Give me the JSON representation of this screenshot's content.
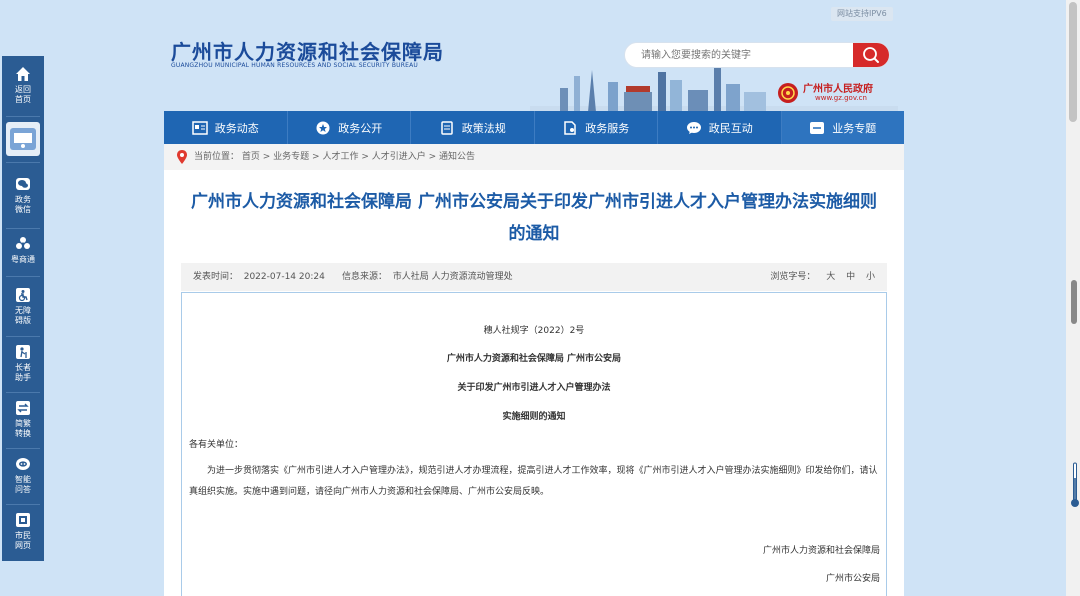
{
  "header": {
    "ipv6": "网站支持IPV6",
    "site_title": "广州市人力资源和社会保障局",
    "site_title_en": "GUANGZHOU MUNICIPAL HUMAN RESOURCES AND SOCIAL SECURITY BUREAU",
    "search_placeholder": "请输入您要搜索的关键字",
    "gov_name": "广州市人民政府",
    "gov_url": "www.gz.gov.cn"
  },
  "nav": [
    {
      "label": "政务动态",
      "icon": "news-icon"
    },
    {
      "label": "政务公开",
      "icon": "star-icon"
    },
    {
      "label": "政策法规",
      "icon": "book-icon"
    },
    {
      "label": "政务服务",
      "icon": "document-icon"
    },
    {
      "label": "政民互动",
      "icon": "chat-icon"
    },
    {
      "label": "业务专题",
      "icon": "list-icon"
    }
  ],
  "breadcrumb": {
    "prefix": "当前位置：",
    "items": [
      "首页",
      "业务专题",
      "人才工作",
      "人才引进入户",
      "通知公告"
    ],
    "sep": " > "
  },
  "article": {
    "title_line1": "广州市人力资源和社会保障局 广州市公安局关于印发广州市引进人才入户管理办法实施细则",
    "title_line2": "的通知",
    "meta_left": "发表时间：  2022-07-14 20:24      信息来源：  市人社局 人力资源流动管理处",
    "font_label": "浏览字号：",
    "font_large": "大",
    "font_medium": "中",
    "font_small": "小",
    "doc_number": "穗人社规字（2022）2号",
    "heading1": "广州市人力资源和社会保障局  广州市公安局",
    "heading2": "关于印发广州市引进人才入户管理办法",
    "heading3": "实施细则的通知",
    "salutation": "各有关单位：",
    "body": "为进一步贯彻落实《广州市引进人才入户管理办法》，规范引进人才办理流程，提高引进人才工作效率，现将《广州市引进人才入户管理办法实施细则》印发给你们，请认真组织实施。实施中遇到问题，请径向广州市人力资源和社会保障局、广州市公安局反映。",
    "sign1": "广州市人力资源和社会保障局",
    "sign2": "广州市公安局"
  },
  "sidebar": [
    {
      "label": "返回首页",
      "line1": "返回",
      "line2": "首页",
      "icon": "home-icon"
    },
    {
      "label": "政务微信",
      "line1": "政务",
      "line2": "微信",
      "icon": "wechat-icon"
    },
    {
      "label": "粤商通",
      "line1": "粤商通",
      "line2": "",
      "icon": "yueshangtong-icon"
    },
    {
      "label": "无障碍版",
      "line1": "无障",
      "line2": "碍版",
      "icon": "accessibility-icon"
    },
    {
      "label": "长者助手",
      "line1": "长者",
      "line2": "助手",
      "icon": "elder-icon"
    },
    {
      "label": "简繁转换",
      "line1": "简繁",
      "line2": "转换",
      "icon": "convert-icon"
    },
    {
      "label": "智能问答",
      "line1": "智能",
      "line2": "问答",
      "icon": "robot-icon"
    },
    {
      "label": "市民网页",
      "line1": "市民",
      "line2": "网页",
      "icon": "citizen-icon"
    }
  ],
  "colors": {
    "page_bg": "#cfe3f6",
    "brand_blue": "#1f66b3",
    "title_blue": "#1c5ba6",
    "search_red": "#d62a2a",
    "sidebar_blue": "#2b5c93",
    "gov_red": "#c61f1f"
  }
}
